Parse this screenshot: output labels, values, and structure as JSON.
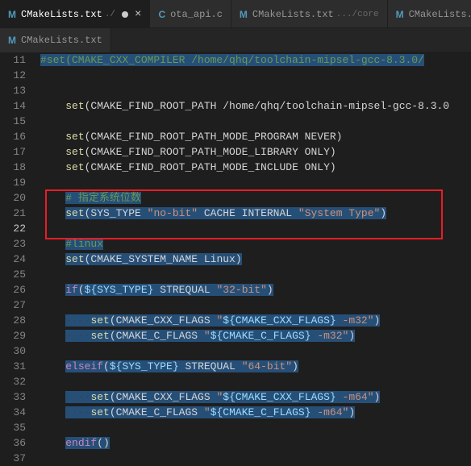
{
  "tabs_row1": [
    {
      "icon": "M",
      "label": "CMakeLists.txt",
      "ext": "./",
      "active": true,
      "close": true
    },
    {
      "icon": "C",
      "label": "ota_api.c",
      "ext": "",
      "active": false,
      "close": false
    },
    {
      "icon": "M",
      "label": "CMakeLists.txt",
      "ext": ".../core",
      "active": false,
      "close": false
    },
    {
      "icon": "M",
      "label": "CMakeLists.t",
      "ext": "",
      "active": false,
      "close": false
    }
  ],
  "tabs_row2": [
    {
      "icon": "M",
      "label": "CMakeLists.txt",
      "ext": "",
      "active": false,
      "close": false
    }
  ],
  "lines": {
    "11": [
      {
        "t": "#set(CMAKE_CXX_COMPILER /home/qhq/toolchain-mipsel-gcc-8.3.0/",
        "c": "cmt",
        "sel": true
      }
    ],
    "12": [],
    "13": [],
    "14": [
      {
        "t": "    ",
        "c": "txt"
      },
      {
        "t": "set",
        "c": "fn"
      },
      {
        "t": "(CMAKE_FIND_ROOT_PATH /home/qhq/toolchain-mipsel-gcc-8.3.0",
        "c": "txt"
      }
    ],
    "15": [],
    "16": [
      {
        "t": "    ",
        "c": "txt"
      },
      {
        "t": "set",
        "c": "fn"
      },
      {
        "t": "(CMAKE_FIND_ROOT_PATH_MODE_PROGRAM NEVER)",
        "c": "txt"
      }
    ],
    "17": [
      {
        "t": "    ",
        "c": "txt"
      },
      {
        "t": "set",
        "c": "fn"
      },
      {
        "t": "(CMAKE_FIND_ROOT_PATH_MODE_LIBRARY ONLY)",
        "c": "txt"
      }
    ],
    "18": [
      {
        "t": "    ",
        "c": "txt"
      },
      {
        "t": "set",
        "c": "fn"
      },
      {
        "t": "(CMAKE_FIND_ROOT_PATH_MODE_INCLUDE ONLY)",
        "c": "txt"
      }
    ],
    "19": [],
    "20": [
      {
        "t": "    ",
        "c": "txt"
      },
      {
        "t": "# 指定系统位数",
        "c": "cmt",
        "sel": true
      }
    ],
    "21": [
      {
        "t": "    ",
        "c": "txt"
      },
      {
        "t": "set",
        "c": "fn",
        "sel": true
      },
      {
        "t": "(SYS_TYPE ",
        "c": "txt",
        "sel": true
      },
      {
        "t": "\"no-bit\"",
        "c": "str",
        "sel": true
      },
      {
        "t": " CACHE INTERNAL ",
        "c": "txt",
        "sel": true
      },
      {
        "t": "\"System Type\"",
        "c": "str",
        "sel": true
      },
      {
        "t": ")",
        "c": "txt",
        "sel": true
      }
    ],
    "22": [],
    "23": [
      {
        "t": "    ",
        "c": "txt"
      },
      {
        "t": "#linux",
        "c": "cmt",
        "sel": true
      }
    ],
    "24": [
      {
        "t": "    ",
        "c": "txt"
      },
      {
        "t": "set",
        "c": "fn",
        "sel": true
      },
      {
        "t": "(CMAKE_SYSTEM_NAME Linux)",
        "c": "txt",
        "sel": true
      }
    ],
    "25": [],
    "26": [
      {
        "t": "    ",
        "c": "txt"
      },
      {
        "t": "if",
        "c": "kw",
        "sel": true
      },
      {
        "t": "(",
        "c": "txt",
        "sel": true
      },
      {
        "t": "${SYS_TYPE}",
        "c": "var",
        "sel": true
      },
      {
        "t": " STREQUAL ",
        "c": "txt",
        "sel": true
      },
      {
        "t": "\"32-bit\"",
        "c": "str",
        "sel": true
      },
      {
        "t": ")",
        "c": "txt",
        "sel": true
      }
    ],
    "27": [
      {
        "t": "    ",
        "c": "txt"
      }
    ],
    "28": [
      {
        "t": "    ",
        "c": "txt"
      },
      {
        "t": "····",
        "c": "dots",
        "sel": true
      },
      {
        "t": "set",
        "c": "fn",
        "sel": true
      },
      {
        "t": "(CMAKE_CXX_FLAGS ",
        "c": "txt",
        "sel": true
      },
      {
        "t": "\"",
        "c": "str",
        "sel": true
      },
      {
        "t": "${CMAKE_CXX_FLAGS}",
        "c": "var",
        "sel": true
      },
      {
        "t": " -m32\"",
        "c": "str",
        "sel": true
      },
      {
        "t": ")",
        "c": "txt",
        "sel": true
      }
    ],
    "29": [
      {
        "t": "    ",
        "c": "txt"
      },
      {
        "t": "····",
        "c": "dots",
        "sel": true
      },
      {
        "t": "set",
        "c": "fn",
        "sel": true
      },
      {
        "t": "(CMAKE_C_FLAGS ",
        "c": "txt",
        "sel": true
      },
      {
        "t": "\"",
        "c": "str",
        "sel": true
      },
      {
        "t": "${CMAKE_C_FLAGS}",
        "c": "var",
        "sel": true
      },
      {
        "t": " -m32\"",
        "c": "str",
        "sel": true
      },
      {
        "t": ")",
        "c": "txt",
        "sel": true
      }
    ],
    "30": [],
    "31": [
      {
        "t": "    ",
        "c": "txt"
      },
      {
        "t": "elseif",
        "c": "kw",
        "sel": true
      },
      {
        "t": "(",
        "c": "txt",
        "sel": true
      },
      {
        "t": "${SYS_TYPE}",
        "c": "var",
        "sel": true
      },
      {
        "t": " STREQUAL ",
        "c": "txt",
        "sel": true
      },
      {
        "t": "\"64-bit\"",
        "c": "str",
        "sel": true
      },
      {
        "t": ")",
        "c": "txt",
        "sel": true
      }
    ],
    "32": [
      {
        "t": "    ",
        "c": "txt"
      }
    ],
    "33": [
      {
        "t": "    ",
        "c": "txt"
      },
      {
        "t": "····",
        "c": "dots",
        "sel": true
      },
      {
        "t": "set",
        "c": "fn",
        "sel": true
      },
      {
        "t": "(CMAKE_CXX_FLAGS ",
        "c": "txt",
        "sel": true
      },
      {
        "t": "\"",
        "c": "str",
        "sel": true
      },
      {
        "t": "${CMAKE_CXX_FLAGS}",
        "c": "var",
        "sel": true
      },
      {
        "t": " -m64\"",
        "c": "str",
        "sel": true
      },
      {
        "t": ")",
        "c": "txt",
        "sel": true
      }
    ],
    "34": [
      {
        "t": "    ",
        "c": "txt"
      },
      {
        "t": "····",
        "c": "dots",
        "sel": true
      },
      {
        "t": "set",
        "c": "fn",
        "sel": true
      },
      {
        "t": "(CMAKE_C_FLAGS ",
        "c": "txt",
        "sel": true
      },
      {
        "t": "\"",
        "c": "str",
        "sel": true
      },
      {
        "t": "${CMAKE_C_FLAGS}",
        "c": "var",
        "sel": true
      },
      {
        "t": " -m64\"",
        "c": "str",
        "sel": true
      },
      {
        "t": ")",
        "c": "txt",
        "sel": true
      }
    ],
    "35": [],
    "36": [
      {
        "t": "    ",
        "c": "txt"
      },
      {
        "t": "endif",
        "c": "kw",
        "sel": true
      },
      {
        "t": "()",
        "c": "txt",
        "sel": true
      }
    ],
    "37": []
  },
  "line_start": 11,
  "line_end": 37,
  "cursor_line": 22
}
